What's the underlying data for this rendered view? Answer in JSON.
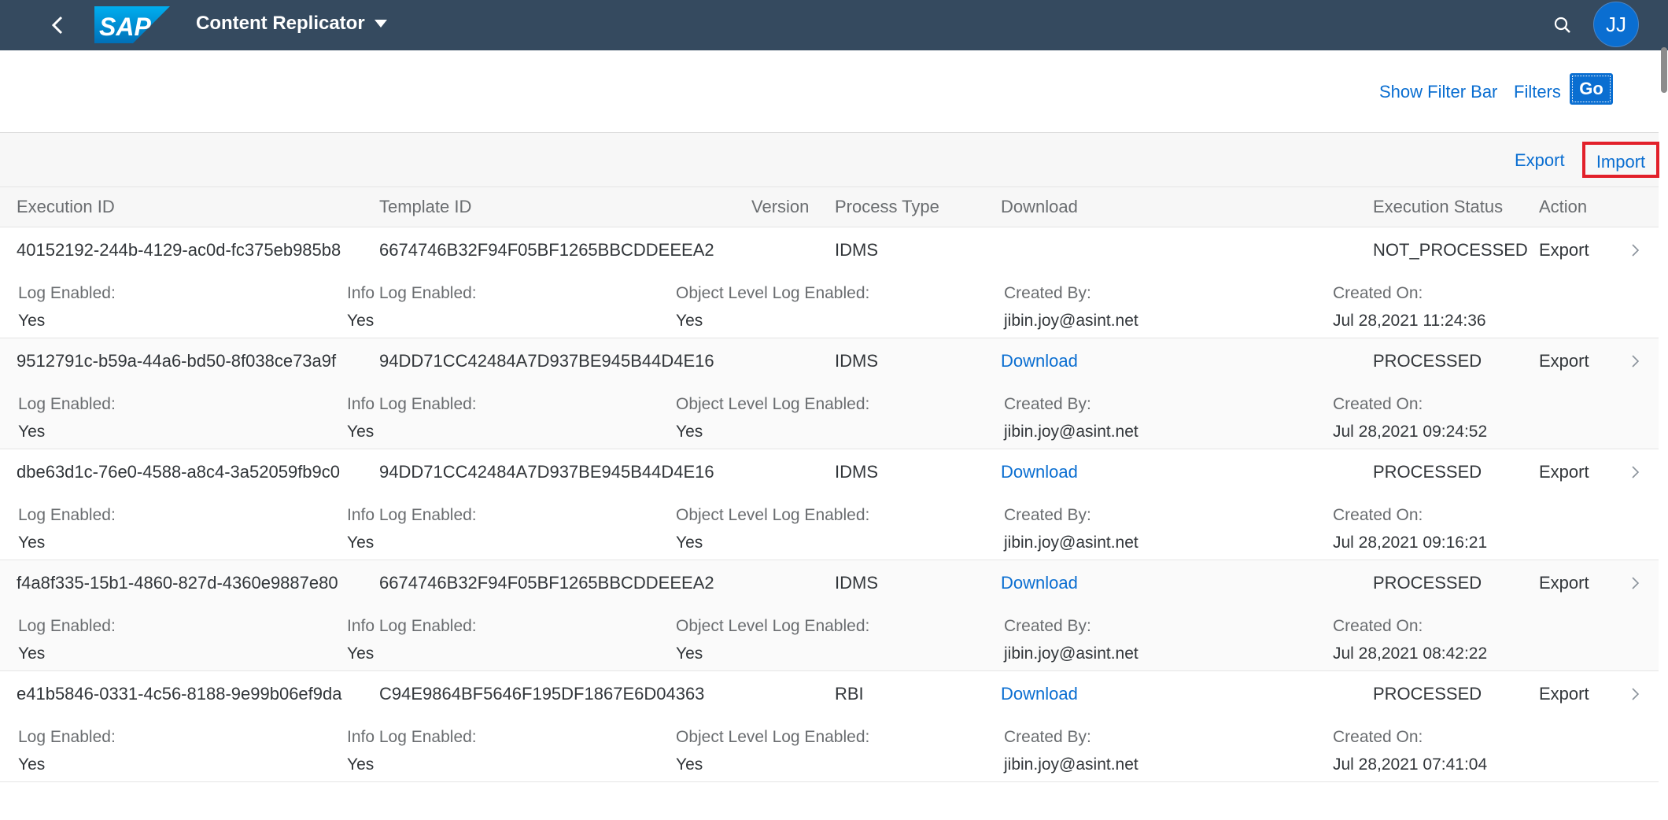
{
  "shell": {
    "title": "Content Replicator",
    "logo_text": "SAP",
    "avatar_initials": "JJ",
    "colors": {
      "shellbar": "#354a5f",
      "accent": "#0a6ed1",
      "highlight": "#e2202a"
    }
  },
  "filterbar": {
    "show_filter_bar": "Show Filter Bar",
    "filters": "Filters",
    "go": "Go"
  },
  "toolbar": {
    "export": "Export",
    "import": "Import"
  },
  "table": {
    "columns": {
      "execution_id": "Execution ID",
      "template_id": "Template ID",
      "version": "Version",
      "process_type": "Process Type",
      "download": "Download",
      "execution_status": "Execution Status",
      "action": "Action"
    },
    "detail_labels": {
      "log_enabled": "Log Enabled:",
      "info_log_enabled": "Info Log Enabled:",
      "object_level_log_enabled": "Object Level Log Enabled:",
      "created_by": "Created By:",
      "created_on": "Created On:"
    },
    "rows": [
      {
        "execution_id": "40152192-244b-4129-ac0d-fc375eb985b8",
        "template_id": "6674746B32F94F05BF1265BBCDDEEEA2",
        "version": "",
        "process_type": "IDMS",
        "download": "",
        "execution_status": "NOT_PROCESSED",
        "action": "Export",
        "log_enabled": "Yes",
        "info_log_enabled": "Yes",
        "object_level_log_enabled": "Yes",
        "created_by": "jibin.joy@asint.net",
        "created_on": "Jul 28,2021 11:24:36"
      },
      {
        "execution_id": "9512791c-b59a-44a6-bd50-8f038ce73a9f",
        "template_id": "94DD71CC42484A7D937BE945B44D4E16",
        "version": "",
        "process_type": "IDMS",
        "download": "Download",
        "execution_status": "PROCESSED",
        "action": "Export",
        "log_enabled": "Yes",
        "info_log_enabled": "Yes",
        "object_level_log_enabled": "Yes",
        "created_by": "jibin.joy@asint.net",
        "created_on": "Jul 28,2021 09:24:52"
      },
      {
        "execution_id": "dbe63d1c-76e0-4588-a8c4-3a52059fb9c0",
        "template_id": "94DD71CC42484A7D937BE945B44D4E16",
        "version": "",
        "process_type": "IDMS",
        "download": "Download",
        "execution_status": "PROCESSED",
        "action": "Export",
        "log_enabled": "Yes",
        "info_log_enabled": "Yes",
        "object_level_log_enabled": "Yes",
        "created_by": "jibin.joy@asint.net",
        "created_on": "Jul 28,2021 09:16:21"
      },
      {
        "execution_id": "f4a8f335-15b1-4860-827d-4360e9887e80",
        "template_id": "6674746B32F94F05BF1265BBCDDEEEA2",
        "version": "",
        "process_type": "IDMS",
        "download": "Download",
        "execution_status": "PROCESSED",
        "action": "Export",
        "log_enabled": "Yes",
        "info_log_enabled": "Yes",
        "object_level_log_enabled": "Yes",
        "created_by": "jibin.joy@asint.net",
        "created_on": "Jul 28,2021 08:42:22"
      },
      {
        "execution_id": "e41b5846-0331-4c56-8188-9e99b06ef9da",
        "template_id": "C94E9864BF5646F195DF1867E6D04363",
        "version": "",
        "process_type": "RBI",
        "download": "Download",
        "execution_status": "PROCESSED",
        "action": "Export",
        "log_enabled": "Yes",
        "info_log_enabled": "Yes",
        "object_level_log_enabled": "Yes",
        "created_by": "jibin.joy@asint.net",
        "created_on": "Jul 28,2021 07:41:04"
      }
    ]
  }
}
